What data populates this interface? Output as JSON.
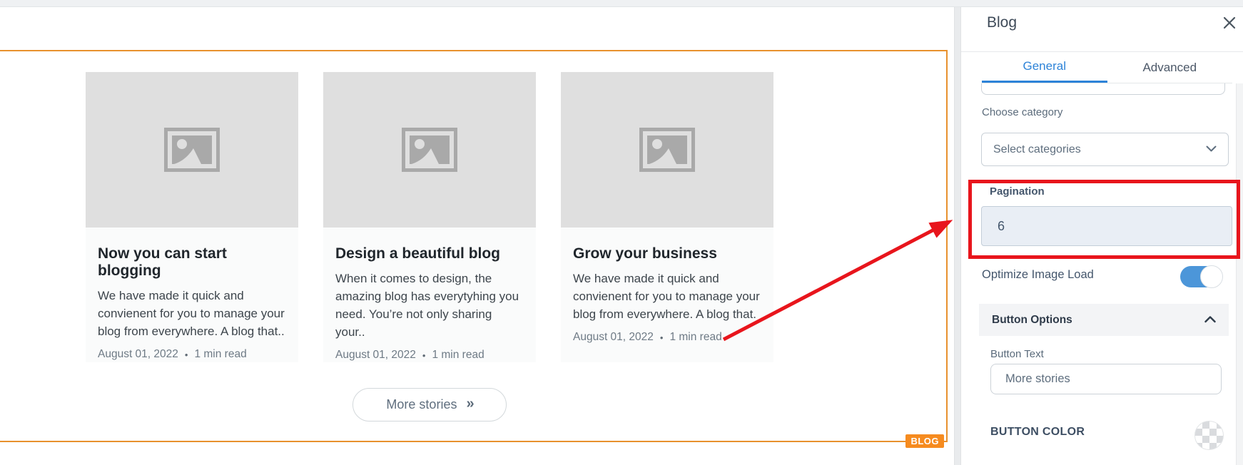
{
  "blog_section": {
    "badge": "BLOG",
    "meta_separator": "•",
    "cards": [
      {
        "title": "Now you can start blogging",
        "excerpt": "We have made it quick and convienent for you to manage your blog from everywhere. A blog that..",
        "date": "August 01, 2022",
        "read_time": "1 min read"
      },
      {
        "title": "Design a beautiful blog",
        "excerpt": "When it comes to design, the amazing blog has everytyhing you need. You’re not only sharing your..",
        "date": "August 01, 2022",
        "read_time": "1 min read"
      },
      {
        "title": "Grow your business",
        "excerpt": "We have made it quick and convienent for you to manage your blog from everywhere. A blog that.",
        "date": "August 01, 2022",
        "read_time": "1 min read"
      }
    ],
    "more_button": {
      "label": "More stories",
      "icon": "»"
    }
  },
  "panel": {
    "title": "Blog",
    "tabs": {
      "general": "General",
      "advanced": "Advanced"
    },
    "category": {
      "label": "Choose category",
      "value": "Select categories"
    },
    "pagination": {
      "label": "Pagination",
      "value": "6"
    },
    "optimize": {
      "label": "Optimize Image Load",
      "state": "on"
    },
    "button_options": {
      "header": "Button Options",
      "text_label": "Button Text",
      "text_value": "More stories",
      "color_label": "BUTTON COLOR"
    }
  },
  "colors": {
    "section_orange": "#e8912d",
    "badge_orange": "#f68b1f",
    "annotation_red": "#e8151c",
    "tab_active_blue": "#2d83d8",
    "toggle_blue": "#4c96d9",
    "pagination_field_bg": "#e9eef5"
  }
}
